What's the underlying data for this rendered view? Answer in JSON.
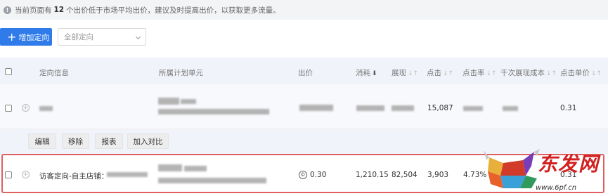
{
  "notice": {
    "prefix": "当前页面有",
    "count": "12",
    "suffix": "个出价低于市场平均出价，建议及时提高出价，以获取更多流量。"
  },
  "toolbar": {
    "add_label": "增加定向",
    "select_value": "全部定向"
  },
  "table": {
    "headers": {
      "info": "定向信息",
      "unit": "所属计划单元",
      "bid": "出价",
      "cost": "消耗",
      "impressions": "展现",
      "clicks": "点击",
      "ctr": "点击率",
      "cpm": "千次展现成本",
      "cpc": "点击单价"
    },
    "row1": {
      "clicks": "15,087",
      "cpc": "0.31"
    },
    "actions": [
      "编辑",
      "移除",
      "报表",
      "加入对比"
    ],
    "row2": {
      "info": "访客定向-自主店铺：",
      "bid": "0.30",
      "cost": "1,210.15",
      "impressions": "82,504",
      "clicks": "3,903",
      "ctr": "4.73%",
      "cpc": "0.31"
    }
  },
  "watermark": {
    "text": "东发网",
    "url": "www.6pf.cn"
  },
  "colors": {
    "primary": "#2f7bea",
    "highlight": "#e06060",
    "watermark": "#d21f1f"
  }
}
